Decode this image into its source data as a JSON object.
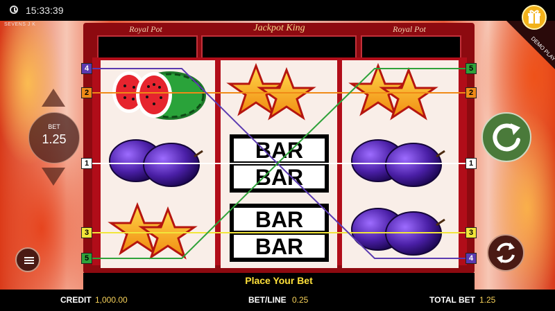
{
  "status_bar": {
    "time": "15:33:39"
  },
  "game": {
    "id_label": "SEVENS J K",
    "header": {
      "left": "Royal Pot",
      "center": "Jackpot King",
      "right": "Royal Pot"
    },
    "bar_label": "BAR"
  },
  "controls": {
    "bet_label": "BET",
    "bet_value": "1.25",
    "demo_label": "DEMO PLAY"
  },
  "message": "Place Your Bet",
  "summary": {
    "credit_label": "CREDIT",
    "credit_value": "1,000.00",
    "betline_label": "BET/LINE",
    "betline_value": "0.25",
    "totalbet_label": "TOTAL BET",
    "totalbet_value": "1.25"
  },
  "paylines": {
    "left": [
      "4",
      "2",
      "1",
      "3",
      "5"
    ],
    "right": [
      "5",
      "2",
      "1",
      "3",
      "4"
    ],
    "colors": {
      "1": "#ffffff",
      "2": "#f08a17",
      "3": "#f2e63a",
      "4": "#5b3ab0",
      "5": "#2fa23a"
    }
  },
  "reels": [
    [
      "watermelon",
      "plum",
      "star"
    ],
    [
      "star",
      "bar",
      "bar"
    ],
    [
      "star",
      "plum",
      "plum"
    ]
  ],
  "icons": [
    "clock-icon",
    "gift-icon",
    "spin-icon",
    "autoplay-icon",
    "menu-icon",
    "arrow-up-icon",
    "arrow-down-icon"
  ]
}
